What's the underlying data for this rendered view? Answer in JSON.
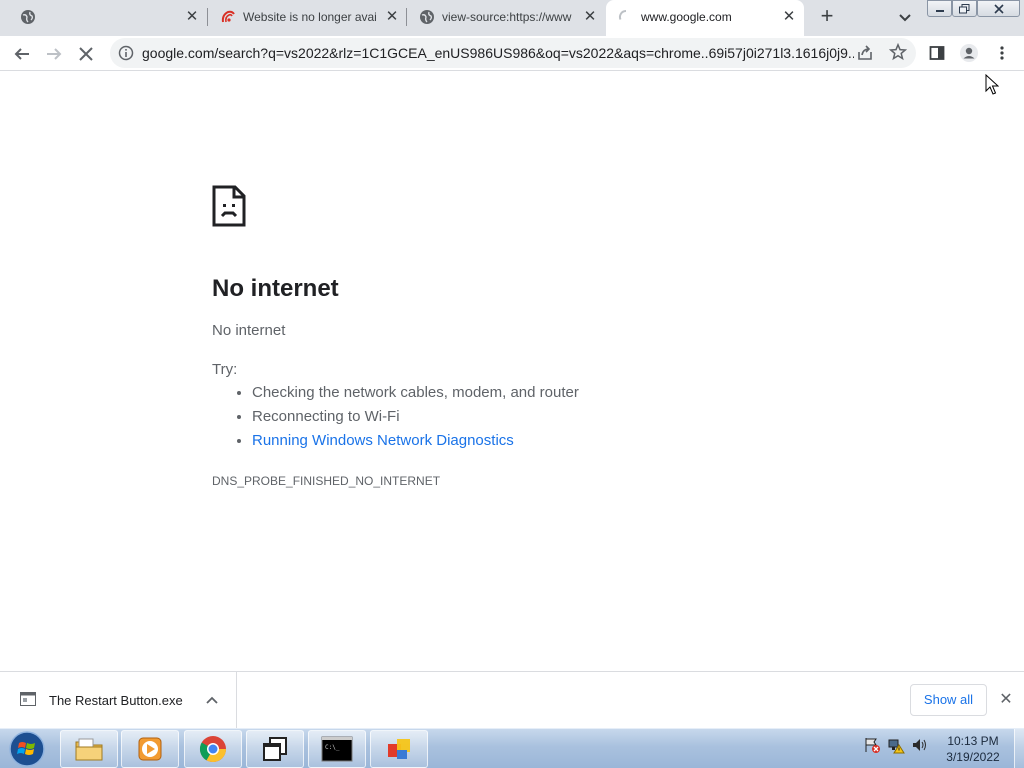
{
  "browser": {
    "tabs": [
      {
        "title": "",
        "favicon": "globe-icon",
        "active": false
      },
      {
        "title": "Website is no longer avai",
        "favicon": "chrome-error-favicon",
        "active": false
      },
      {
        "title": "view-source:https://www",
        "favicon": "globe-icon",
        "active": false
      },
      {
        "title": "www.google.com",
        "favicon": "loading-spinner-icon",
        "active": true
      }
    ],
    "new_tab_icon": "plus-icon",
    "tab_search_icon": "chevron-down-icon",
    "address_bar": {
      "url": "google.com/search?q=vs2022&rlz=1C1GCEA_enUS986US986&oq=vs2022&aqs=chrome..69i57j0i271l3.1616j0j9..."
    },
    "toolbar_icons": [
      "back-arrow-icon",
      "forward-arrow-icon",
      "stop-loading-icon",
      "info-icon",
      "share-icon",
      "star-icon",
      "side-panel-icon",
      "profile-icon",
      "more-menu-icon"
    ]
  },
  "error_page": {
    "heading": "No internet",
    "subheading": "No internet",
    "try_label": "Try:",
    "suggestions": [
      {
        "text": "Checking the network cables, modem, and router",
        "link": false
      },
      {
        "text": "Reconnecting to Wi-Fi",
        "link": false
      },
      {
        "text": "Running Windows Network Diagnostics",
        "link": true
      }
    ],
    "error_code": "DNS_PROBE_FINISHED_NO_INTERNET"
  },
  "download_shelf": {
    "file_name": "The Restart Button.exe",
    "show_all_label": "Show all"
  },
  "taskbar": {
    "apps": [
      "file-explorer-icon",
      "media-player-icon",
      "chrome-icon",
      "window-switcher-icon",
      "command-prompt-icon",
      "app-icon"
    ],
    "time": "10:13 PM",
    "date": "3/19/2022"
  },
  "colors": {
    "tab_strip": "#dee1e6",
    "link_blue": "#1a73e8",
    "heading_text": "#202124",
    "body_text": "#5f6368"
  }
}
